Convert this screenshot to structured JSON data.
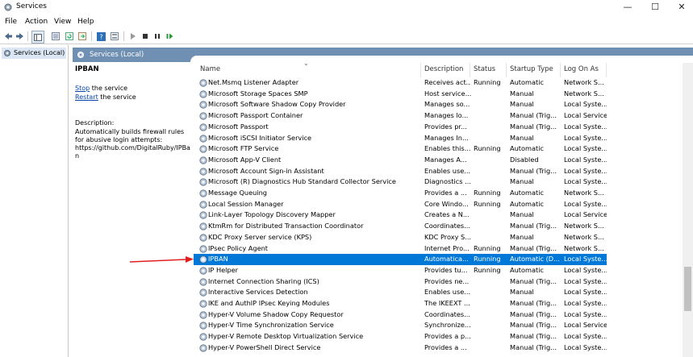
{
  "window": {
    "title": "Services",
    "minimize": "—",
    "maximize": "☐",
    "close": "✕"
  },
  "menu": [
    "File",
    "Action",
    "View",
    "Help"
  ],
  "tree": {
    "item": "Services (Local)"
  },
  "panel": {
    "header": "Services (Local)"
  },
  "details": {
    "service_name": "IPBAN",
    "stop_link": "Stop",
    "stop_suffix": " the service",
    "restart_link": "Restart",
    "restart_suffix": " the service",
    "description_label": "Description:",
    "description": "Automatically builds firewall rules for abusive login attempts: https://github.com/DigitalRuby/IPBan"
  },
  "columns": [
    "Name",
    "Description",
    "Status",
    "Startup Type",
    "Log On As"
  ],
  "rows": [
    [
      "Net.Msmq Listener Adapter",
      "Receives act...",
      "Running",
      "Automatic",
      "Network S..."
    ],
    [
      "Microsoft Storage Spaces SMP",
      "Host service...",
      "",
      "Manual",
      "Network S..."
    ],
    [
      "Microsoft Software Shadow Copy Provider",
      "Manages so...",
      "",
      "Manual",
      "Local Syste..."
    ],
    [
      "Microsoft Passport Container",
      "Manages lo...",
      "",
      "Manual (Trig...",
      "Local Service"
    ],
    [
      "Microsoft Passport",
      "Provides pr...",
      "",
      "Manual (Trig...",
      "Local Syste..."
    ],
    [
      "Microsoft iSCSI Initiator Service",
      "Manages In...",
      "",
      "Manual",
      "Local Syste..."
    ],
    [
      "Microsoft FTP Service",
      "Enables this...",
      "Running",
      "Automatic",
      "Local Syste..."
    ],
    [
      "Microsoft App-V Client",
      "Manages A...",
      "",
      "Disabled",
      "Local Syste..."
    ],
    [
      "Microsoft Account Sign-in Assistant",
      "Enables use...",
      "",
      "Manual (Trig...",
      "Local Syste..."
    ],
    [
      "Microsoft (R) Diagnostics Hub Standard Collector Service",
      "Diagnostics ...",
      "",
      "Manual",
      "Local Syste..."
    ],
    [
      "Message Queuing",
      "Provides a ...",
      "Running",
      "Automatic",
      "Network S..."
    ],
    [
      "Local Session Manager",
      "Core Windo...",
      "Running",
      "Automatic",
      "Local Syste..."
    ],
    [
      "Link-Layer Topology Discovery Mapper",
      "Creates a N...",
      "",
      "Manual",
      "Local Service"
    ],
    [
      "KtmRm for Distributed Transaction Coordinator",
      "Coordinates...",
      "",
      "Manual (Trig...",
      "Network S..."
    ],
    [
      "KDC Proxy Server service (KPS)",
      "KDC Proxy S...",
      "",
      "Manual",
      "Network S..."
    ],
    [
      "IPsec Policy Agent",
      "Internet Pro...",
      "Running",
      "Manual (Trig...",
      "Network S..."
    ],
    [
      "IPBAN",
      "Automatica...",
      "Running",
      "Automatic (D...",
      "Local Syste..."
    ],
    [
      "IP Helper",
      "Provides tu...",
      "Running",
      "Automatic",
      "Local Syste..."
    ],
    [
      "Internet Connection Sharing (ICS)",
      "Provides ne...",
      "",
      "Manual (Trig...",
      "Local Syste..."
    ],
    [
      "Interactive Services Detection",
      "Enables use...",
      "",
      "Manual",
      "Local Syste..."
    ],
    [
      "IKE and AuthIP IPsec Keying Modules",
      "The IKEEXT ...",
      "",
      "Manual (Trig...",
      "Local Syste..."
    ],
    [
      "Hyper-V Volume Shadow Copy Requestor",
      "Coordinates...",
      "",
      "Manual (Trig...",
      "Local Syste..."
    ],
    [
      "Hyper-V Time Synchronization Service",
      "Synchronize...",
      "",
      "Manual (Trig...",
      "Local Service"
    ],
    [
      "Hyper-V Remote Desktop Virtualization Service",
      "Provides a p...",
      "",
      "Manual (Trig...",
      "Local Syste..."
    ],
    [
      "Hyper-V PowerShell Direct Service",
      "Provides a ...",
      "",
      "Manual (Trig...",
      "Local Syste..."
    ]
  ],
  "selected_row": 16,
  "colors": {
    "selection": "#0078d7",
    "panel_header": "#6f8fb3",
    "arrow": "#e02020"
  }
}
